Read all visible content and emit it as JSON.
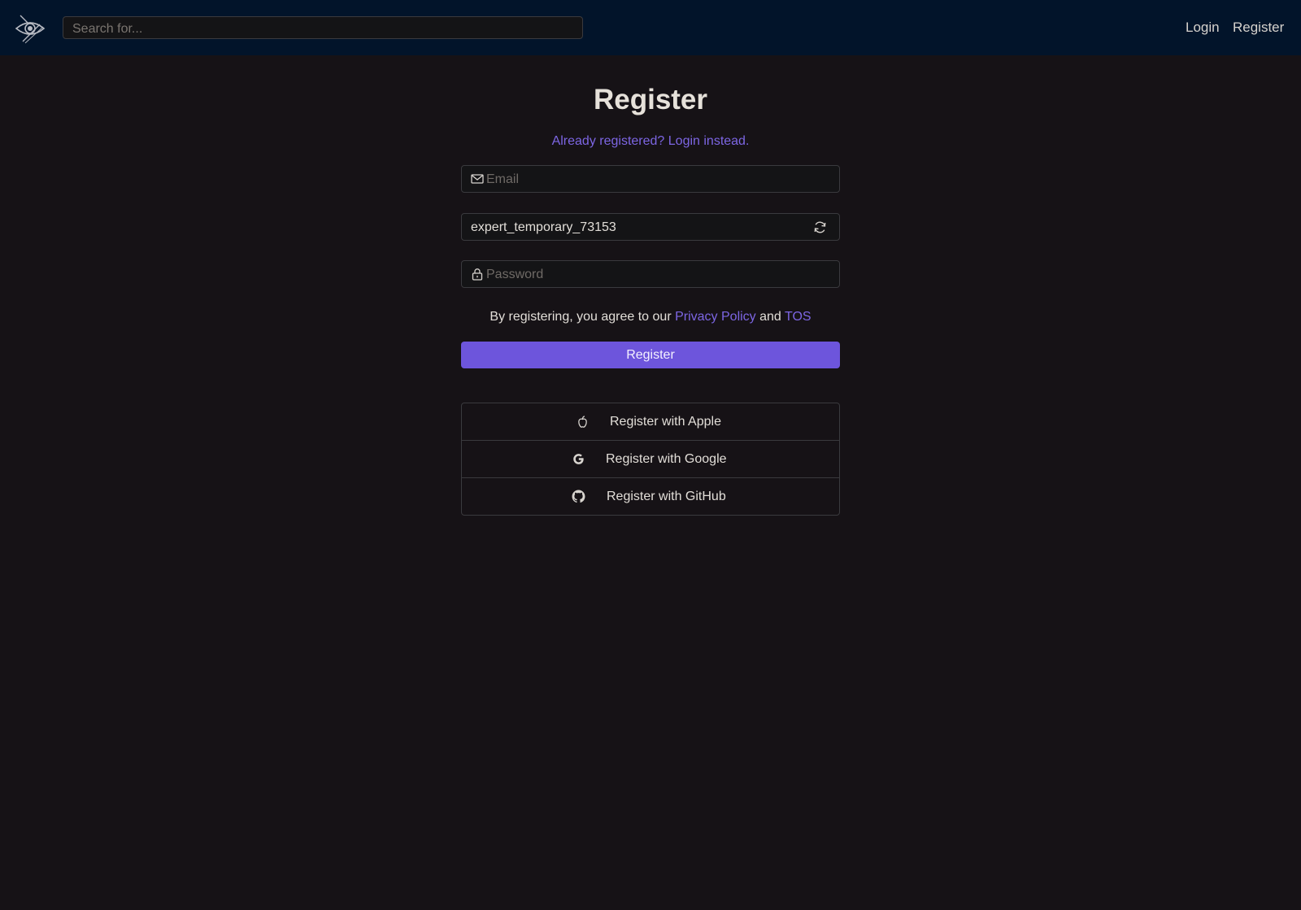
{
  "navbar": {
    "search_placeholder": "Search for...",
    "login_label": "Login",
    "register_label": "Register"
  },
  "page": {
    "title": "Register",
    "login_link": "Already registered? Login instead."
  },
  "form": {
    "email_placeholder": "Email",
    "username_value": "expert_temporary_73153",
    "password_placeholder": "Password",
    "terms_prefix": "By registering, you agree to our",
    "privacy_label": "Privacy Policy",
    "terms_and": "and",
    "tos_label": "TOS",
    "submit_label": "Register"
  },
  "oauth": {
    "apple_label": "Register with Apple",
    "google_label": "Register with Google",
    "github_label": "Register with GitHub"
  },
  "icons": {
    "logo": "eye-logo-icon",
    "email": "envelope-icon",
    "refresh": "refresh-icon",
    "password": "lock-icon",
    "apple": "apple-icon",
    "google": "google-icon",
    "github": "github-icon"
  },
  "colors": {
    "navbar_bg": "#02142a",
    "page_bg": "#161216",
    "accent": "#6d55dc",
    "link": "#7d66e4"
  }
}
